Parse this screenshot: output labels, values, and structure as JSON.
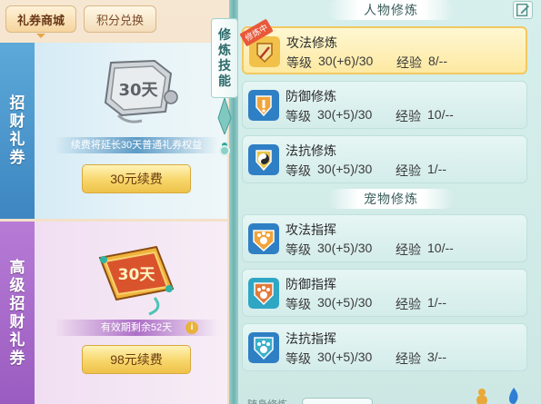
{
  "tabs": {
    "coupon_mall": "礼券商城",
    "points_exchange": "积分兑换"
  },
  "card_normal": {
    "title": "招财礼券",
    "ticket_text": "30天",
    "note": "续费将延长30天普通礼券权益",
    "button": "30元续费",
    "accent": "#3d86c2"
  },
  "card_premium": {
    "title": "高级招财礼券",
    "ticket_text": "30天",
    "note": "有效期剩余52天",
    "button": "98元续费",
    "accent": "#9a5cc0"
  },
  "side_tab": {
    "label": "修炼技能"
  },
  "sections": {
    "character": "人物修炼",
    "pet": "宠物修炼"
  },
  "labels": {
    "level": "等级",
    "exp": "经验"
  },
  "character_skills": [
    {
      "name": "攻法修炼",
      "level": "30(+6)/30",
      "exp": "8/--",
      "badge": "修炼中",
      "selected": true,
      "icon": "sword-shield-icon"
    },
    {
      "name": "防御修炼",
      "level": "30(+5)/30",
      "exp": "10/--",
      "selected": false,
      "icon": "defense-shield-icon"
    },
    {
      "name": "法抗修炼",
      "level": "30(+5)/30",
      "exp": "1/--",
      "selected": false,
      "icon": "yin-yang-shield-icon"
    }
  ],
  "pet_skills": [
    {
      "name": "攻法指挥",
      "level": "30(+5)/30",
      "exp": "10/--",
      "icon": "paw-attack-icon"
    },
    {
      "name": "防御指挥",
      "level": "30(+5)/30",
      "exp": "1/--",
      "icon": "paw-defense-icon"
    },
    {
      "name": "法抗指挥",
      "level": "30(+5)/30",
      "exp": "3/--",
      "icon": "paw-resist-icon"
    }
  ],
  "bottom": {
    "label": "随身修炼"
  },
  "colors": {
    "selected_row": "#fde9a2",
    "row": "#d3ecea",
    "button_gold": "#f7d66a"
  }
}
